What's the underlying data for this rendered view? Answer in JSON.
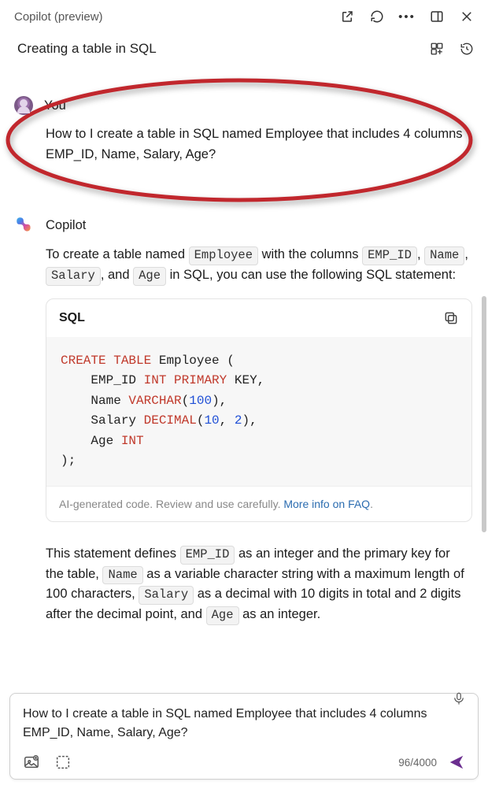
{
  "header": {
    "title": "Copilot (preview)"
  },
  "subheader": {
    "title": "Creating a table in SQL"
  },
  "user_msg": {
    "name": "You",
    "body": "How to I create a table in SQL named Employee that includes 4 columns EMP_ID, Name, Salary, Age?"
  },
  "assistant_msg": {
    "name": "Copilot",
    "intro_before": "To create a table named ",
    "chip_employee": "Employee",
    "intro_mid1": " with the columns ",
    "chip_empid": "EMP_ID",
    "sep_comma": ", ",
    "chip_name": "Name",
    "chip_salary": "Salary",
    "sep_and": ", and ",
    "chip_age": "Age",
    "intro_after": " in SQL, you can use the following SQL statement:"
  },
  "code": {
    "lang": "SQL",
    "l1a": "CREATE",
    "l1b": "TABLE",
    "l1c": " Employee (",
    "l2a": "    EMP_ID ",
    "l2b": "INT",
    "l2c": "PRIMARY",
    "l2d": " KEY,",
    "l3a": "    Name ",
    "l3b": "VARCHAR",
    "l3c": "(",
    "l3d": "100",
    "l3e": "),",
    "l4a": "    Salary ",
    "l4b": "DECIMAL",
    "l4c": "(",
    "l4d": "10",
    "l4e": ", ",
    "l4f": "2",
    "l4g": "),",
    "l5a": "    Age ",
    "l5b": "INT",
    "l6": ");",
    "footer_text": "AI-generated code. Review and use carefully. ",
    "footer_link": "More info on FAQ"
  },
  "explain": {
    "p1": "This statement defines ",
    "chip_empid": "EMP_ID",
    "p2": " as an integer and the primary key for the table, ",
    "chip_name": "Name",
    "p3": " as a variable character string with a maximum length of 100 characters, ",
    "chip_salary": "Salary",
    "p4": " as a decimal with 10 digits in total and 2 digits after the decimal point, and ",
    "chip_age": "Age",
    "p5": " as an integer."
  },
  "composer": {
    "text": "How to I create a table in SQL named Employee that includes 4 columns EMP_ID, Name, Salary, Age?",
    "counter": "96/4000"
  },
  "meta": {
    "domain": "Computer-Use"
  }
}
